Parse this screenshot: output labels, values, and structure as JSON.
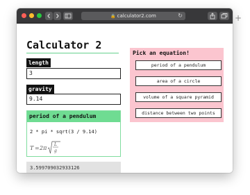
{
  "browser": {
    "url": "calculator2.com",
    "back_icon": "chevron-left-icon",
    "forward_icon": "chevron-right-icon",
    "new_tab_label": "+"
  },
  "page": {
    "title": "Calculator 2"
  },
  "fields": {
    "length": {
      "label": "length",
      "value": "3"
    },
    "gravity": {
      "label": "gravity",
      "value": "9.14"
    }
  },
  "formula": {
    "name": "period of a pendulum",
    "expression": "2 * pi * sqrt(3 / 9.14)",
    "math_lhs": "T",
    "math_eq": "=",
    "math_coef": "2π",
    "math_num": "L",
    "math_den": "g"
  },
  "result": {
    "value": "3.599709032933126"
  },
  "picker": {
    "title": "Pick an equation!",
    "options": [
      {
        "label": "period of a pendulum"
      },
      {
        "label": "area of a circle"
      },
      {
        "label": "volume of a square pyramid"
      },
      {
        "label": "distance between two points"
      }
    ]
  },
  "colors": {
    "accent_green": "#6fdc92",
    "picker_pink": "#fbc5cf",
    "label_black": "#111111"
  }
}
